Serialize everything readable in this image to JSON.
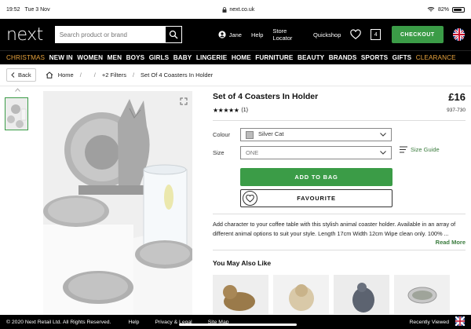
{
  "status_bar": {
    "time": "19:52",
    "date": "Tue 3 Nov",
    "url": "next.co.uk",
    "battery": "82%",
    "battery_level": 0.82
  },
  "header": {
    "logo": "next",
    "search_placeholder": "Search product or brand",
    "account_name": "Jane",
    "help": "Help",
    "store_locator": "Store Locator",
    "quickshop": "Quickshop",
    "bag_count": "4",
    "checkout": "CHECKOUT"
  },
  "nav": {
    "christmas": "CHRISTMAS",
    "items": [
      "NEW IN",
      "WOMEN",
      "MEN",
      "BOYS",
      "GIRLS",
      "BABY",
      "LINGERIE",
      "HOME",
      "FURNITURE",
      "BEAUTY",
      "BRANDS",
      "SPORTS",
      "GIFTS"
    ],
    "clearance": "CLEARANCE"
  },
  "breadcrumb": {
    "back": "Back",
    "home": "Home",
    "sep": "/",
    "filters": "+2 Filters",
    "current": "Set Of 4 Coasters In Holder"
  },
  "product": {
    "title": "Set of 4 Coasters In Holder",
    "price": "£16",
    "code": "937-730",
    "stars": "★★★★★",
    "rating": 5,
    "reviews": "(1)",
    "colour_label": "Colour",
    "colour_value": "Silver Cat",
    "size_label": "Size",
    "size_value": "ONE",
    "size_guide": "Size Guide",
    "add_to_bag": "ADD TO BAG",
    "favourite": "FAVOURITE",
    "description_1": "Add character to your coffee table with this stylish animal coaster holder. Available in an array of",
    "description_2": "different animal options to suit your style. Length 17cm Width 12cm Wipe clean only. 100% ...",
    "read_more": "Read More",
    "you_may_also_like": "You May Also Like"
  },
  "footer": {
    "copyright": "© 2020 Next Retail Ltd. All Rights Reserved.",
    "help": "Help",
    "privacy": "Privacy & Legal",
    "sitemap": "Site Map",
    "recently_viewed": "Recently Viewed"
  },
  "colors": {
    "accent_green": "#3b9c47",
    "nav_orange": "#e8a33d",
    "link_green": "#3b7c3e"
  }
}
